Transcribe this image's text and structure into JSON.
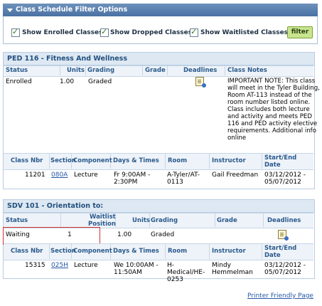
{
  "filter": {
    "title": "Class Schedule Filter Options",
    "checkboxes": [
      {
        "label": "Show Enrolled Classes",
        "checked": true
      },
      {
        "label": "Show Dropped Classes",
        "checked": true
      },
      {
        "label": "Show Waitlisted Classes",
        "checked": true
      }
    ],
    "button_label": "filter"
  },
  "course1": {
    "title": "PED 116 - Fitness And Wellness",
    "status_headers": {
      "status": "Status",
      "units": "Units",
      "grading": "Grading",
      "grade": "Grade",
      "deadlines": "Deadlines",
      "notes": "Class Notes"
    },
    "status_row": {
      "status": "Enrolled",
      "units": "1.00",
      "grading": "Graded",
      "grade": "",
      "notes": "IMPORTANT NOTE: This class will meet in the Tyler Building, Room AT-113 instead of the room number listed online. Class includes both lecture and activity and meets PED 116 and PED activity elective requirements. Additional info online"
    },
    "section_headers": {
      "nbr": "Class Nbr",
      "section": "Section",
      "component": "Component",
      "days": "Days & Times",
      "room": "Room",
      "instructor": "Instructor",
      "dates_line1": "Start/End",
      "dates_line2": "Date"
    },
    "section_row": {
      "nbr": "11201",
      "section": "080A",
      "component": "Lecture",
      "days_line1": "Fr 9:00AM -",
      "days_line2": "2:30PM",
      "room_line1": "A-Tyler/AT-",
      "room_line2": "0113",
      "instructor": "Gail Freedman",
      "dates_line1": "03/12/2012 -",
      "dates_line2": "05/07/2012"
    }
  },
  "course2": {
    "title": "SDV 101 - Orientation to:",
    "status_headers": {
      "status": "Status",
      "waitlist_line1": "Waitlist",
      "waitlist_line2": "Position",
      "units": "Units",
      "grading": "Grading",
      "grade": "Grade",
      "deadlines": "Deadlines"
    },
    "status_row": {
      "status": "Waiting",
      "position": "1",
      "units": "1.00",
      "grading": "Graded",
      "grade": ""
    },
    "section_headers": {
      "nbr": "Class Nbr",
      "section": "Section",
      "component": "Component",
      "days": "Days & Times",
      "room": "Room",
      "instructor": "Instructor",
      "dates_line1": "Start/End",
      "dates_line2": "Date"
    },
    "section_row": {
      "nbr": "15315",
      "section": "025H",
      "component": "Lecture",
      "days_line1": "We 10:00AM -",
      "days_line2": "11:50AM",
      "room_line1": "H-",
      "room_line2": "Medical/HE-",
      "room_line3": "0253",
      "instructor_line1": "Mindy",
      "instructor_line2": "Hemmelman",
      "dates_line1": "03/12/2012 -",
      "dates_line2": "05/07/2012"
    }
  },
  "footer": {
    "printer_link": "Printer Friendly Page"
  },
  "colors": {
    "header_bar": "#4a71a3",
    "panel_title_bg": "#dde8f3",
    "header_text": "#2a5a8c",
    "link": "#2657a5",
    "filter_button": "#c8e58e",
    "highlight_box": "#d03030"
  },
  "icons": {
    "collapse": "triangle-down-icon",
    "notes": "class-notes-icon",
    "deadlines": "deadlines-icon"
  }
}
